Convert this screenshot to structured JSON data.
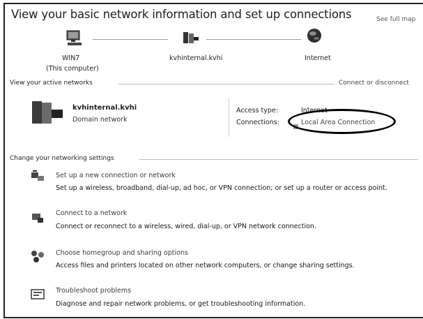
{
  "header": {
    "title": "View your basic network information and set up connections",
    "see_full_map": "See full map"
  },
  "map": {
    "computer_name": "WIN7",
    "computer_sub": "(This computer)",
    "network_name": "kvhinternal.kvhi",
    "internet": "Internet"
  },
  "active": {
    "section_label": "View your active networks",
    "connect_label": "Connect or disconnect",
    "network_name": "kvhinternal.kvhi",
    "network_type": "Domain network",
    "access_type_label": "Access type:",
    "access_type_value": "Internet",
    "connections_label": "Connections:",
    "connection_link": "Local Area Connection"
  },
  "settings": {
    "section_label": "Change your networking settings",
    "tasks": [
      {
        "title": "Set up a new connection or network",
        "desc": "Set up a wireless, broadband, dial-up, ad hoc, or VPN connection; or set up a router or access point."
      },
      {
        "title": "Connect to a network",
        "desc": "Connect or reconnect to a wireless, wired, dial-up, or VPN network connection."
      },
      {
        "title": "Choose homegroup and sharing options",
        "desc": "Access files and printers located on other network computers, or change sharing settings."
      },
      {
        "title": "Troubleshoot problems",
        "desc": "Diagnose and repair network problems, or get troubleshooting information."
      }
    ]
  },
  "icons": [
    "computer-icon",
    "network-icon",
    "globe-icon",
    "network-bench-icon",
    "connection-icon",
    "setup-connection-icon",
    "connect-network-icon",
    "homegroup-icon",
    "troubleshoot-icon"
  ]
}
